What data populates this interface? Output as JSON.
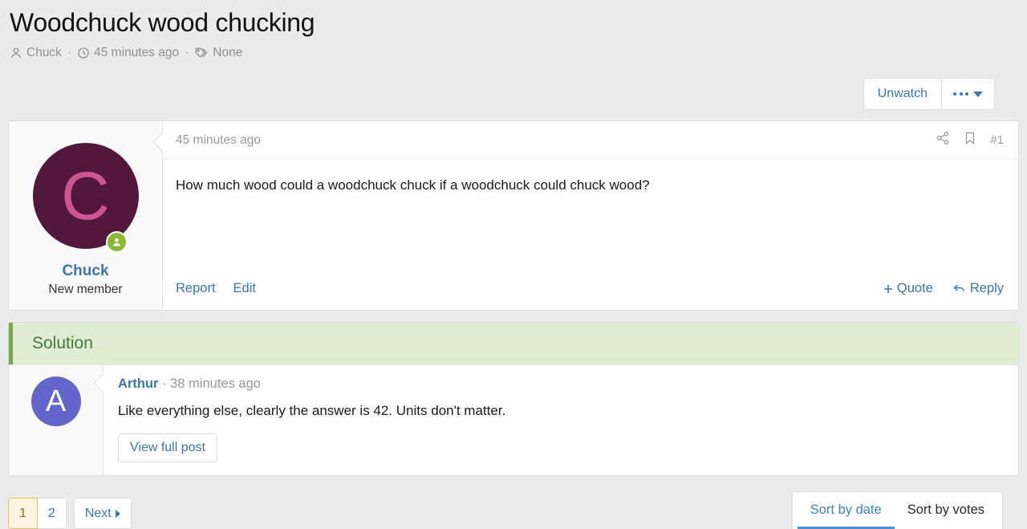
{
  "thread": {
    "title": "Woodchuck wood chucking",
    "meta": {
      "author": "Chuck",
      "time": "45 minutes ago",
      "tags": "None",
      "separator": "·"
    }
  },
  "actionbar": {
    "unwatch_label": "Unwatch",
    "more_menu_label": "More options"
  },
  "post": {
    "time": "45 minutes ago",
    "number": "#1",
    "body": "How much wood could a woodchuck chuck if a woodchuck could chuck wood?",
    "author": {
      "initial": "C",
      "name": "Chuck",
      "rank": "New member",
      "avatar_bg": "#52173c",
      "avatar_fg": "#cf5494",
      "status_color": "#8cb935"
    },
    "actions": {
      "report": "Report",
      "edit": "Edit",
      "quote": "+ Quote",
      "quote_label": "Quote",
      "reply": "Reply"
    }
  },
  "solution": {
    "banner_label": "Solution",
    "banner_bg": "#dfedd3",
    "banner_border": "#74a950",
    "banner_text_color": "#417a3e",
    "reply": {
      "initial": "A",
      "author": "Arthur",
      "separator": "·",
      "time": "38 minutes ago",
      "body": "Like everything else, clearly the answer is 42. Units don't matter.",
      "view_full_post": "View full post",
      "avatar_bg": "#6265ca"
    }
  },
  "footer": {
    "pagination": {
      "page1": "1",
      "page2": "2",
      "next": "Next",
      "active_bg": "#fdf5e2",
      "active_border": "#e8c06a"
    },
    "sort_tabs": [
      {
        "label": "Sort by date",
        "active": true
      },
      {
        "label": "Sort by votes",
        "active": false
      }
    ]
  }
}
